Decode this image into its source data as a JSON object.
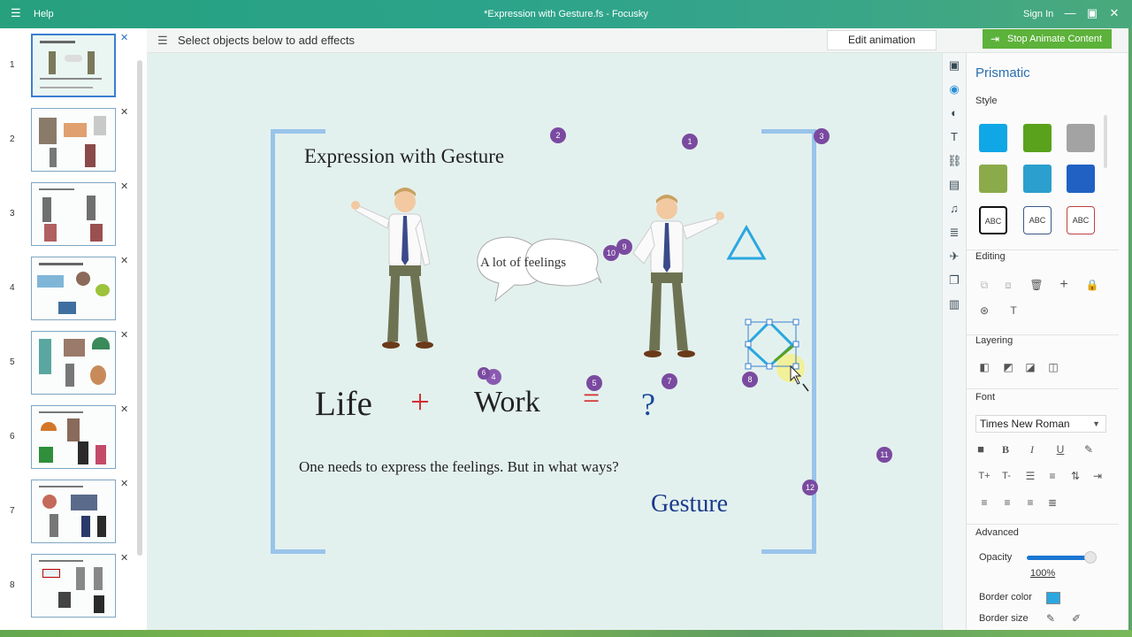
{
  "window": {
    "menu_help": "Help",
    "title": "*Expression with Gesture.fs - Focusky",
    "sign_in": "Sign In"
  },
  "thumbnails": [
    {
      "num": "1"
    },
    {
      "num": "2"
    },
    {
      "num": "3"
    },
    {
      "num": "4"
    },
    {
      "num": "5"
    },
    {
      "num": "6"
    },
    {
      "num": "7"
    },
    {
      "num": "8"
    }
  ],
  "toolbar": {
    "hint": "Select objects below to add effects",
    "edit_animation": "Edit animation",
    "stop_animate": "Stop Animate Content"
  },
  "slide": {
    "title": "Expression with Gesture",
    "bubble": "A lot of feelings",
    "life": "Life",
    "plus": "+",
    "work": "Work",
    "equals": "=",
    "question": "?",
    "sentence": "One needs to express the feelings. But in what ways?",
    "gesture": "Gesture",
    "badges": [
      "1",
      "2",
      "3",
      "4",
      "5",
      "6",
      "7",
      "8",
      "9",
      "10",
      "11",
      "12"
    ]
  },
  "panel": {
    "title": "Prismatic",
    "style_label": "Style",
    "swatch_colors": [
      "#10a7e6",
      "#5aa21c",
      "#a3a3a3",
      "#8bab4a",
      "#2b9fcd",
      "#2161c4"
    ],
    "abc_label": "ABC",
    "editing_label": "Editing",
    "layering_label": "Layering",
    "font_label": "Font",
    "font_name": "Times New Roman",
    "advanced_label": "Advanced",
    "opacity_label": "Opacity",
    "opacity_value": "100%",
    "opacity_fraction": 1.0,
    "border_color_label": "Border color",
    "border_size_label": "Border size"
  },
  "colors": {
    "accent_green": "#5cb23a",
    "title_blue": "#2a6fb0",
    "badge_purple": "#7a4aa0"
  }
}
